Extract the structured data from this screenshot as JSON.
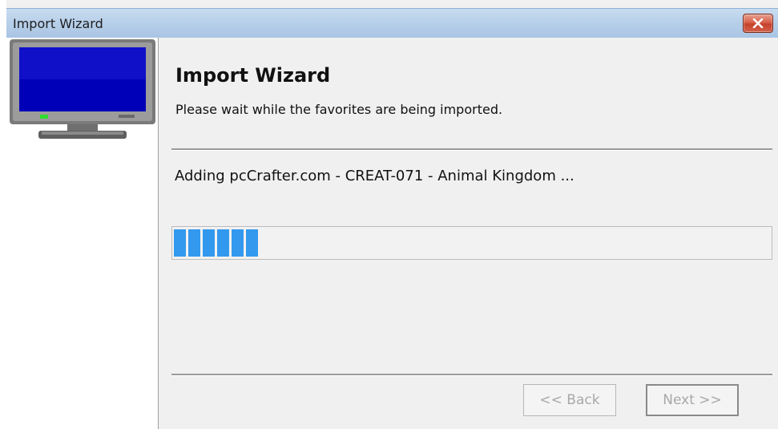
{
  "window": {
    "title": "Import Wizard",
    "close_icon": "close-icon"
  },
  "header": {
    "title": "Import Wizard",
    "subtitle": "Please wait while the favorites are being imported."
  },
  "status": {
    "text": "Adding pcCrafter.com - CREAT-071 - Animal Kingdom ..."
  },
  "progress": {
    "blocks_filled": 6,
    "fraction": 0.22,
    "color": "#3399ee"
  },
  "buttons": {
    "back_label": "<< Back",
    "next_label": "Next >>",
    "back_enabled": false,
    "next_enabled": false
  },
  "sidebar": {
    "icon": "monitor-icon"
  }
}
